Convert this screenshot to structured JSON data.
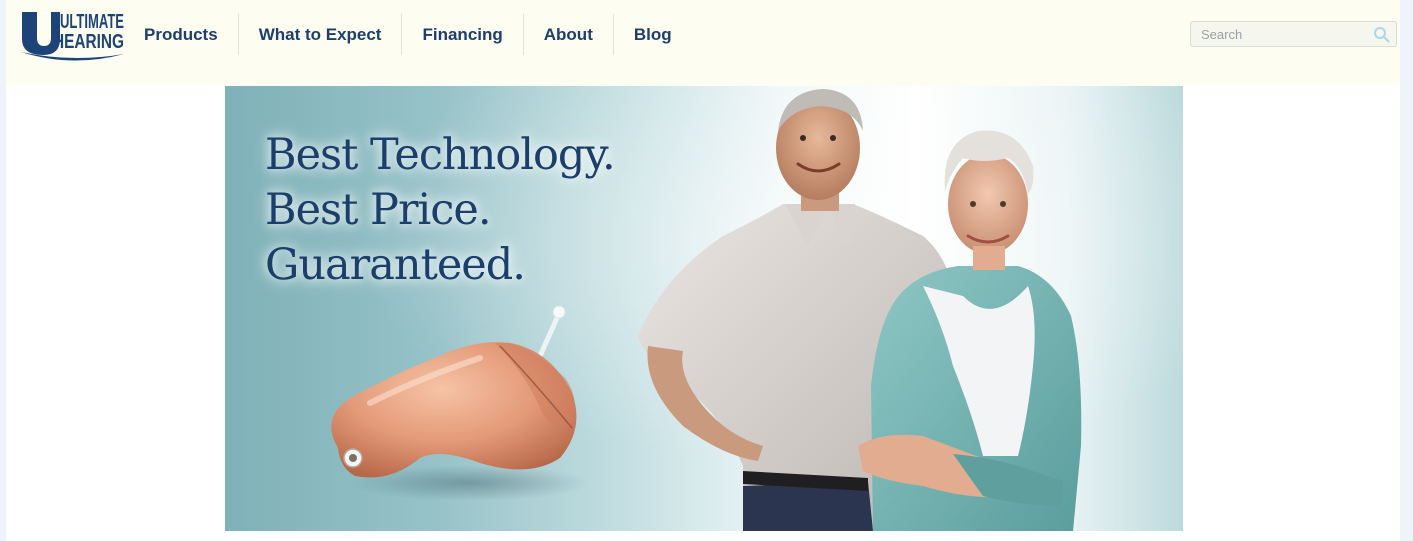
{
  "brand": {
    "logo_line1": "ULTIMATE",
    "logo_line2": "HEARING",
    "color": "#1d4478"
  },
  "nav": {
    "items": [
      {
        "label": "Products"
      },
      {
        "label": "What to Expect"
      },
      {
        "label": "Financing"
      },
      {
        "label": "About"
      },
      {
        "label": "Blog"
      }
    ]
  },
  "search": {
    "placeholder": "Search",
    "icon": "search-icon"
  },
  "hero": {
    "headline_lines": [
      "Best Technology.",
      "Best Price.",
      "Guaranteed."
    ],
    "image_subject": "hearing aid and smiling senior couple"
  }
}
